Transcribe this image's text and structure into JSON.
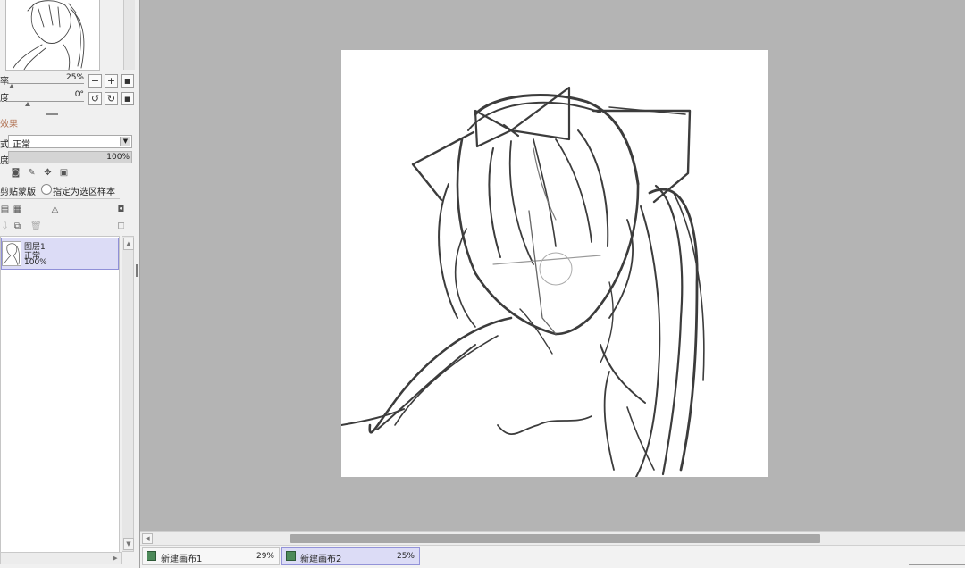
{
  "navigator": {
    "zoom_label": "率",
    "zoom_value": "25%",
    "angle_label": "度",
    "angle_value": "0°"
  },
  "layer_props": {
    "effects_title": "效果",
    "mode_label": "式",
    "mode_value": "正常",
    "opacity_label": "度",
    "opacity_value": "100%",
    "clip_label": "剪贴蒙版",
    "selection_source_label": "指定为选区样本"
  },
  "layers": [
    {
      "name": "图层1",
      "mode": "正常",
      "opacity": "100%"
    }
  ],
  "tabs": [
    {
      "name": "新建画布1",
      "zoom": "29%",
      "active": false
    },
    {
      "name": "新建画布2",
      "zoom": "25%",
      "active": true
    }
  ],
  "colors": {
    "workspace_bg": "#b4b4b4",
    "panel_bg": "#f0f0f0",
    "selection": "#dcdcf6",
    "selection_border": "#9090d8"
  }
}
